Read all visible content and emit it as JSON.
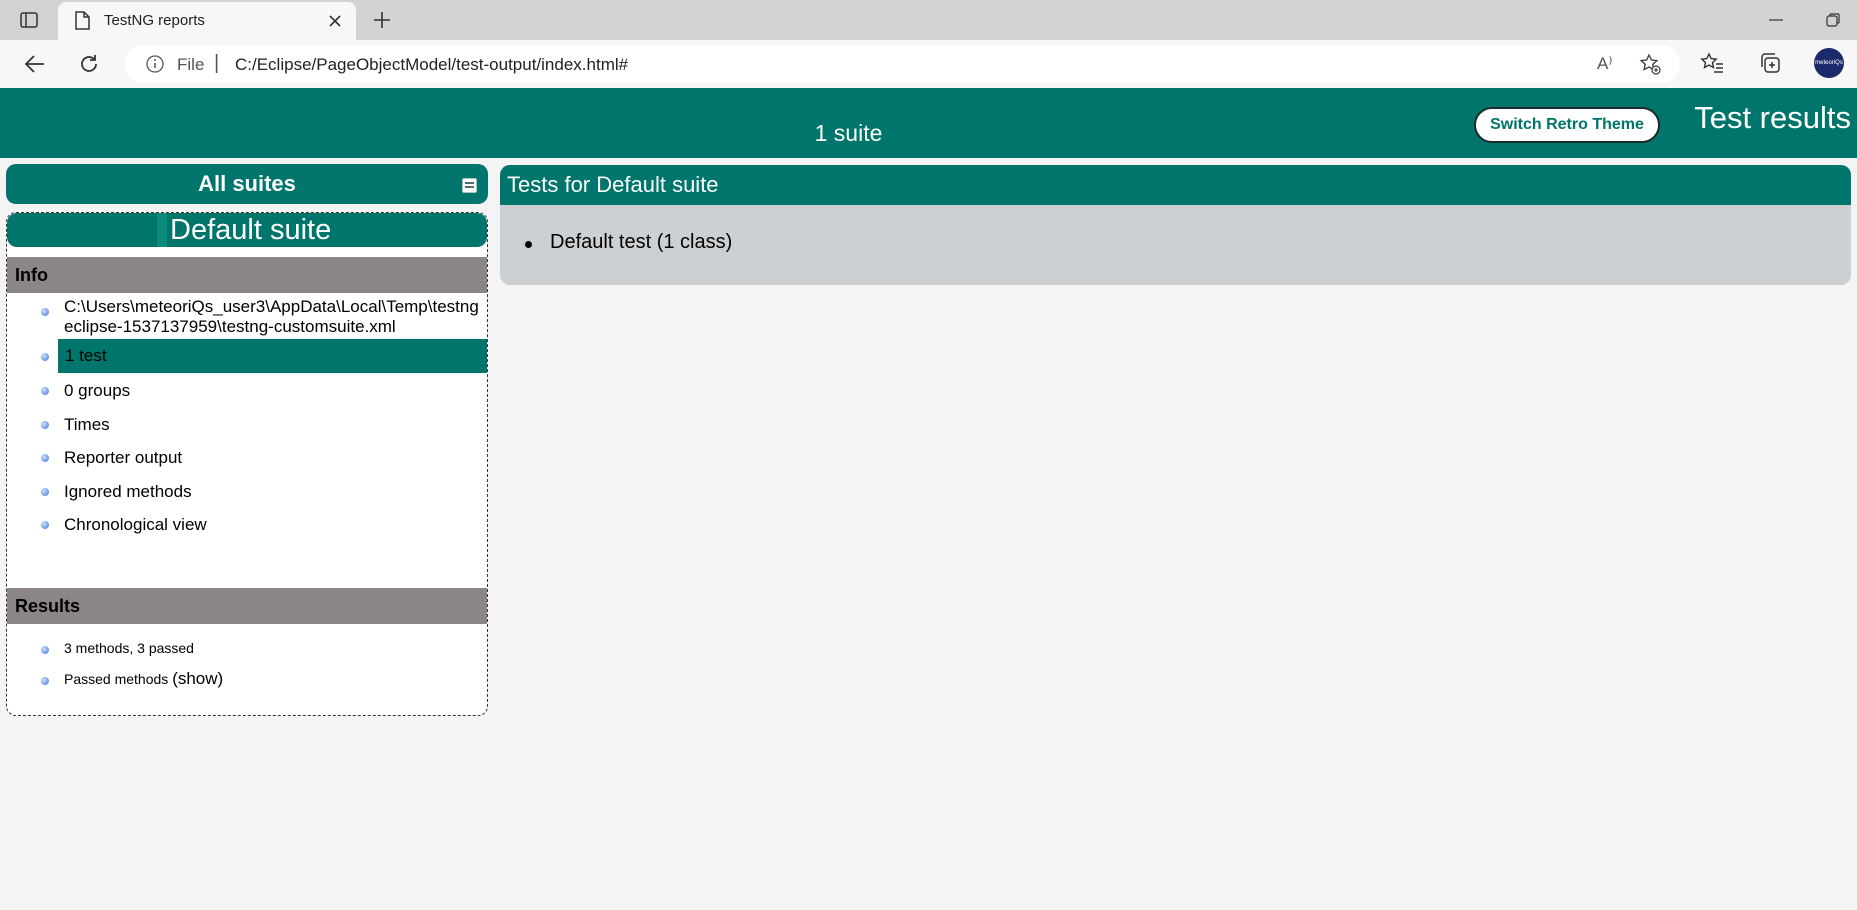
{
  "browser": {
    "tab_title": "TestNG reports",
    "address_scheme": "File",
    "address_separator": "|",
    "address_url": "C:/Eclipse/PageObjectModel/test-output/index.html#",
    "read_aloud_glyph": "A⁾",
    "profile_label": "meteoriQs",
    "icons": [
      "sidebar-toggle-icon",
      "document-icon",
      "close-icon",
      "plus-icon",
      "minimize-icon",
      "restore-icon",
      "back-arrow-icon",
      "refresh-icon",
      "info-icon",
      "read-aloud-icon",
      "add-favorite-icon",
      "favorites-icon",
      "collections-icon"
    ]
  },
  "banner": {
    "suite_count": "1 suite",
    "retro_button": "Switch Retro Theme",
    "title": "Test results"
  },
  "sidebar": {
    "all_suites": "All suites",
    "suite_name": "Default suite",
    "info_heading": "Info",
    "info_items": [
      {
        "label": "C:\\Users\\meteoriQs_user3\\AppData\\Local\\Temp\\testng-eclipse-1537137959\\testng-customsuite.xml",
        "line1": "C:\\Users\\meteoriQs_user3\\AppData\\Local\\Temp\\testng",
        "line2": "eclipse-1537137959\\testng-customsuite.xml"
      },
      {
        "label": "1 test",
        "selected": true
      },
      {
        "label": "0 groups"
      },
      {
        "label": "Times"
      },
      {
        "label": "Reporter output"
      },
      {
        "label": "Ignored methods"
      },
      {
        "label": "Chronological view"
      }
    ],
    "results_heading": "Results",
    "result_summary": "3 methods, 3 passed",
    "passed_methods_label": "Passed methods",
    "show_link": "(show)"
  },
  "main": {
    "heading": "Tests for Default suite",
    "tests": [
      {
        "label": "Default test (1 class)"
      }
    ]
  },
  "colors": {
    "accent": "#00756b",
    "section_header": "#8b8685",
    "panel_body": "#cdd0d2",
    "page_background": "#f4f4f4"
  }
}
